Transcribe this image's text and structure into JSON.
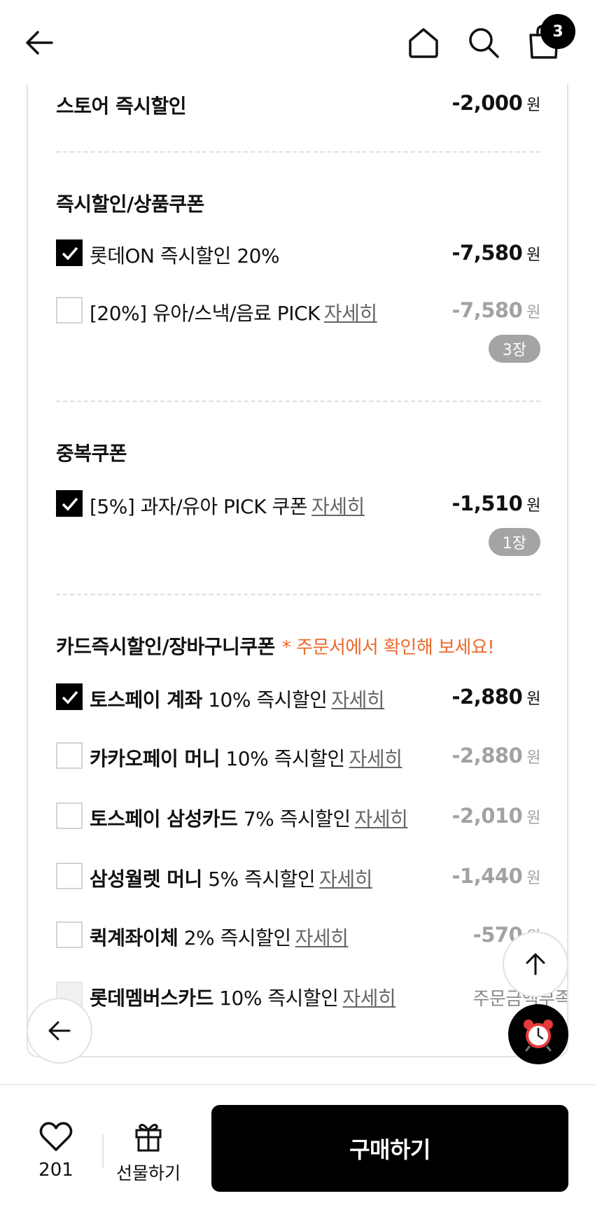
{
  "header": {
    "cart_count": "3"
  },
  "store_discount": {
    "label": "스토어 즉시할인",
    "amount": "-2,000",
    "won": "원"
  },
  "instant_coupon": {
    "title": "즉시할인/상품쿠폰",
    "items": [
      {
        "label": "롯데ON 즉시할인 20%",
        "detail": "",
        "amount": "-7,580",
        "won": "원",
        "checked": true
      },
      {
        "label": "[20%] 유아/스낵/음료 PICK",
        "detail": "자세히",
        "amount": "-7,580",
        "won": "원",
        "checked": false,
        "badge": "3장"
      }
    ]
  },
  "duplicate_coupon": {
    "title": "중복쿠폰",
    "items": [
      {
        "label": "[5%] 과자/유아 PICK 쿠폰",
        "detail": "자세히",
        "amount": "-1,510",
        "won": "원",
        "checked": true,
        "badge": "1장"
      }
    ]
  },
  "card_discount": {
    "title": "카드즉시할인/장바구니쿠폰",
    "note": "* 주문서에서 확인해 보세요!",
    "items": [
      {
        "name": "토스페이 계좌",
        "desc": "10% 즉시할인",
        "detail": "자세히",
        "amount": "-2,880",
        "won": "원",
        "checked": true
      },
      {
        "name": "카카오페이 머니",
        "desc": "10% 즉시할인",
        "detail": "자세히",
        "amount": "-2,880",
        "won": "원",
        "checked": false
      },
      {
        "name": "토스페이 삼성카드",
        "desc": "7% 즉시할인",
        "detail": "자세히",
        "amount": "-2,010",
        "won": "원",
        "checked": false
      },
      {
        "name": "삼성월렛 머니",
        "desc": "5% 즉시할인",
        "detail": "자세히",
        "amount": "-1,440",
        "won": "원",
        "checked": false
      },
      {
        "name": "퀵계좌이체",
        "desc": "2% 즉시할인",
        "detail": "자세히",
        "amount": "-570",
        "won": "원",
        "checked": false
      },
      {
        "name": "롯데멤버스카드",
        "desc": "10% 즉시할인",
        "detail": "자세히",
        "amount": "주문금액부족",
        "won": "",
        "checked": false
      }
    ]
  },
  "bottom_bar": {
    "like_count": "201",
    "gift_label": "선물하기",
    "buy_label": "구매하기"
  }
}
